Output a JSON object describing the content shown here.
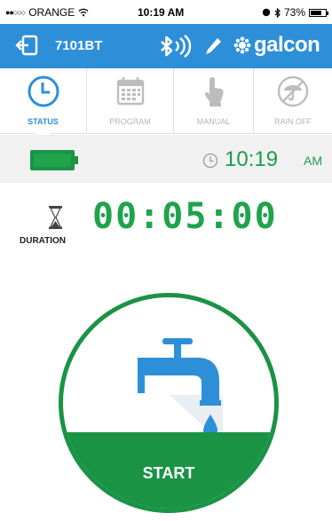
{
  "status_bar": {
    "carrier": "ORANGE",
    "time": "10:19 AM",
    "battery_percent": "73%"
  },
  "header": {
    "device_id": "7101BT",
    "brand": "galcon"
  },
  "tabs": [
    {
      "label": "STATUS",
      "icon": "clock-icon",
      "active": true
    },
    {
      "label": "PROGRAM",
      "icon": "calendar-icon",
      "active": false
    },
    {
      "label": "MANUAL",
      "icon": "hand-icon",
      "active": false
    },
    {
      "label": "RAIN OFF",
      "icon": "rain-off-icon",
      "active": false
    }
  ],
  "status": {
    "battery_level": 1.0,
    "clock_time": "10:19",
    "ampm": "AM"
  },
  "duration": {
    "label": "DURATION",
    "value": "00:05:00"
  },
  "start": {
    "label": "START"
  },
  "colors": {
    "header_blue": "#2d8fd8",
    "accent_green": "#1a9345",
    "digit_green": "#1fa34c"
  }
}
